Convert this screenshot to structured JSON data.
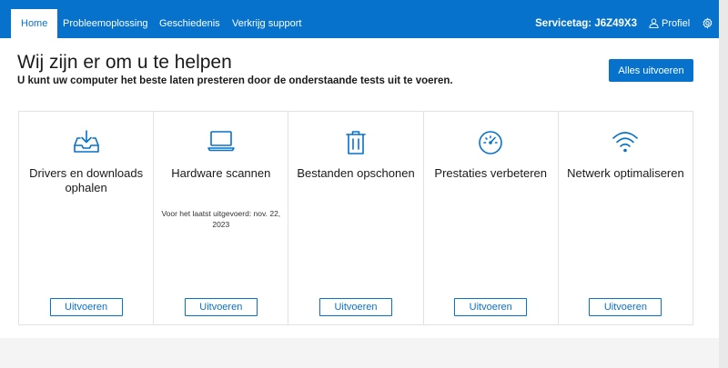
{
  "nav": {
    "tabs": [
      {
        "label": "Home",
        "active": true
      },
      {
        "label": "Probleemoplossing",
        "active": false
      },
      {
        "label": "Geschiedenis",
        "active": false
      },
      {
        "label": "Verkrijg support",
        "active": false
      }
    ],
    "service_tag": "Servicetag: J6Z49X3",
    "profile_label": "Profiel",
    "profile_icon": "person-icon",
    "settings_icon": "gear-icon"
  },
  "header": {
    "title": "Wij zijn er om u te helpen",
    "subtitle": "U kunt uw computer het beste laten presteren door de onderstaande tests uit te voeren.",
    "run_all_label": "Alles uitvoeren"
  },
  "cards": [
    {
      "icon": "download-tray-icon",
      "title": "Drivers en downloads ophalen",
      "subtitle": "",
      "button": "Uitvoeren"
    },
    {
      "icon": "laptop-icon",
      "title": "Hardware scannen",
      "subtitle": "Voor het laatst uitgevoerd: nov. 22, 2023",
      "button": "Uitvoeren"
    },
    {
      "icon": "trash-icon",
      "title": "Bestanden opschonen",
      "subtitle": "",
      "button": "Uitvoeren"
    },
    {
      "icon": "speedometer-icon",
      "title": "Prestaties verbeteren",
      "subtitle": "",
      "button": "Uitvoeren"
    },
    {
      "icon": "wifi-icon",
      "title": "Netwerk optimaliseren",
      "subtitle": "",
      "button": "Uitvoeren"
    }
  ],
  "colors": {
    "accent": "#0672cb",
    "background": "#ffffff",
    "text": "#1a1a1a"
  }
}
